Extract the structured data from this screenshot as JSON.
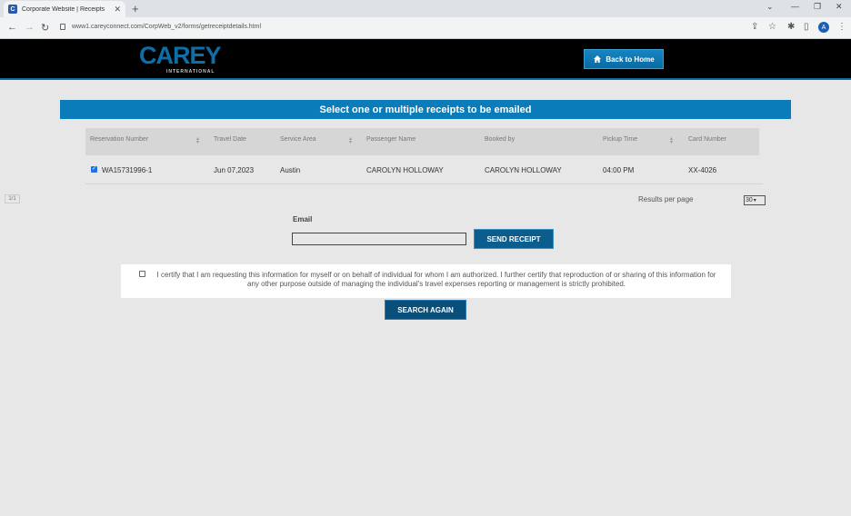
{
  "browser": {
    "tab_title": "Corporate Website | Receipts",
    "tab_favicon": "C",
    "new_tab_icon": "+",
    "url": "www1.careyconnect.com/CorpWeb_v2/forms/getreceiptdetails.html",
    "profile_initial": "A"
  },
  "header": {
    "logo_text": "CAREY",
    "logo_sub": "INTERNATIONAL",
    "back_label": "Back to Home"
  },
  "banner": "Select one or multiple receipts to be emailed",
  "table": {
    "columns": [
      "Reservation Number",
      "Travel Date",
      "Service Area",
      "Passenger Name",
      "Booked by",
      "Pickup Time",
      "Card Number"
    ],
    "rows": [
      {
        "checked": true,
        "reservation": "WA15731996-1",
        "travel_date": "Jun 07,2023",
        "service_area": "Austin",
        "passenger": "CAROLYN HOLLOWAY",
        "booked_by": "CAROLYN HOLLOWAY",
        "pickup_time": "04:00 PM",
        "card": "XX-4026"
      }
    ]
  },
  "pager": "1/1",
  "results_per_page": {
    "label": "Results per page",
    "value": "30"
  },
  "email": {
    "label": "Email",
    "value": "",
    "send_label": "SEND RECEIPT"
  },
  "certify": {
    "checked": false,
    "text": "I certify that I am requesting this information for myself or on behalf of individual for whom I am authorized. I further certify that reproduction of or sharing of this information for any other purpose outside of managing the individual's travel expenses reporting or management is strictly prohibited."
  },
  "search_again_label": "SEARCH AGAIN"
}
